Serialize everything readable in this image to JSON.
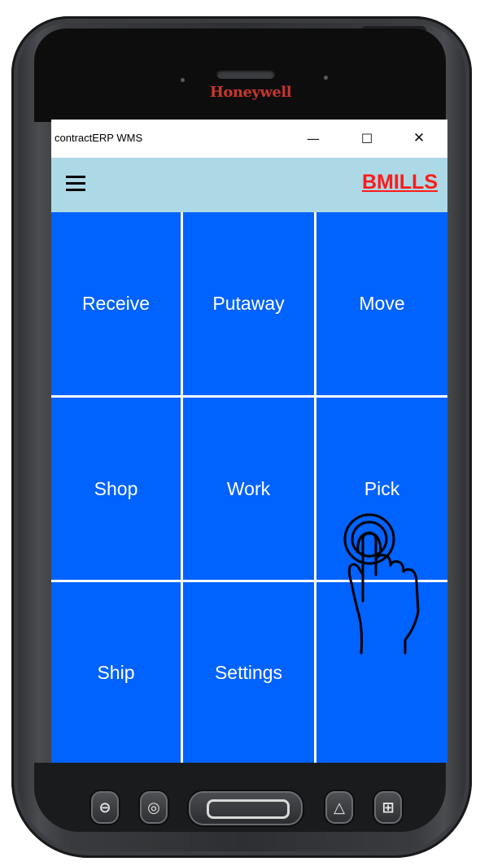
{
  "device": {
    "brand": "Honeywell"
  },
  "window": {
    "title": "contractERP WMS",
    "minimize_glyph": "—",
    "maximize_glyph": "☐",
    "close_glyph": "✕"
  },
  "appbar": {
    "menu_icon": "hamburger-icon",
    "user": "BMILLS"
  },
  "tiles": [
    {
      "label": "Receive"
    },
    {
      "label": "Putaway"
    },
    {
      "label": "Move"
    },
    {
      "label": "Shop"
    },
    {
      "label": "Work"
    },
    {
      "label": "Pick"
    },
    {
      "label": "Ship"
    },
    {
      "label": "Settings"
    },
    {
      "label": ""
    }
  ],
  "hardware_buttons": {
    "back_icon": "back-icon",
    "camera_icon": "camera-icon",
    "home_icon": "home-button",
    "scan_icon": "scan-icon",
    "apps_icon": "apps-icon"
  },
  "colors": {
    "tile_bg": "#0062ff",
    "appbar_bg": "#add8e6",
    "user_color": "#ff1a1a"
  },
  "overlay": {
    "icon": "tap-hand-icon"
  }
}
